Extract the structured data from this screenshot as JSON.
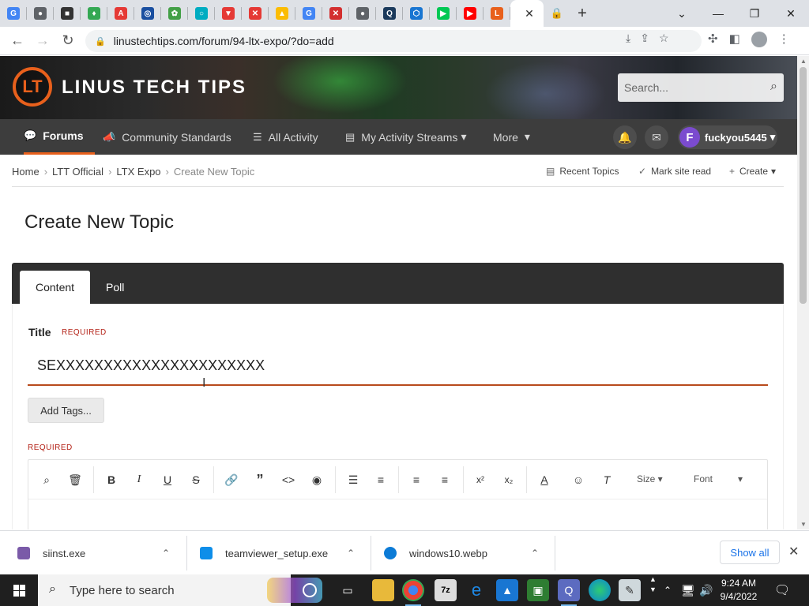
{
  "browser": {
    "tabs": [
      {
        "name": "tab-google",
        "glyph": "G",
        "color": "#4285f4"
      },
      {
        "name": "tab-globe",
        "glyph": "●",
        "color": "#5f6368"
      },
      {
        "name": "tab-dark",
        "glyph": "■",
        "color": "#333333"
      },
      {
        "name": "tab-pin",
        "glyph": "♦",
        "color": "#34a853"
      },
      {
        "name": "tab-adobe",
        "glyph": "A",
        "color": "#e53935"
      },
      {
        "name": "tab-blue-circle",
        "glyph": "◎",
        "color": "#1a4fa0"
      },
      {
        "name": "tab-green",
        "glyph": "✿",
        "color": "#43a047"
      },
      {
        "name": "tab-teal",
        "glyph": "○",
        "color": "#00acc1"
      },
      {
        "name": "tab-shield1",
        "glyph": "▼",
        "color": "#e53935"
      },
      {
        "name": "tab-shield2",
        "glyph": "✕",
        "color": "#e53935"
      },
      {
        "name": "tab-drive",
        "glyph": "▲",
        "color": "#fbbc04"
      },
      {
        "name": "tab-google2",
        "glyph": "G",
        "color": "#4285f4"
      },
      {
        "name": "tab-shield3",
        "glyph": "✕",
        "color": "#d32f2f"
      },
      {
        "name": "tab-globe2",
        "glyph": "●",
        "color": "#5f6368"
      },
      {
        "name": "tab-q",
        "glyph": "Q",
        "color": "#1b3a5c"
      },
      {
        "name": "tab-hex",
        "glyph": "⬡",
        "color": "#1976d2"
      },
      {
        "name": "tab-play",
        "glyph": "▶",
        "color": "#00c853"
      },
      {
        "name": "tab-youtube",
        "glyph": "▶",
        "color": "#ff0000"
      },
      {
        "name": "tab-ltt",
        "glyph": "L",
        "color": "#e8601c"
      }
    ],
    "active_tab_close": "✕",
    "after_tab": {
      "glyph": "🔒",
      "color": "#f5c518"
    },
    "new_tab": "+",
    "url": "linustechtips.com/forum/94-ltx-expo/?do=add"
  },
  "site": {
    "logo_glyph": "LT",
    "logo_text": "LINUS TECH TIPS",
    "search_placeholder": "Search...",
    "nav": [
      {
        "label": "Forums",
        "icon": "💬",
        "active": true
      },
      {
        "label": "Community Standards",
        "icon": "📣"
      },
      {
        "label": "All Activity",
        "icon": "☰"
      },
      {
        "label": "My Activity Streams",
        "icon": "▤",
        "caret": "▾"
      },
      {
        "label": "More",
        "caret": "▾"
      }
    ],
    "user": {
      "initial": "F",
      "name": "fuckyou5445",
      "caret": "▾"
    }
  },
  "breadcrumb": {
    "items": [
      "Home",
      "LTT Official",
      "LTX Expo"
    ],
    "current": "Create New Topic",
    "separator": "›",
    "actions": [
      {
        "label": "Recent Topics",
        "icon": "▤"
      },
      {
        "label": "Mark site read",
        "icon": "✓"
      },
      {
        "label": "Create",
        "icon": "+",
        "caret": "▾"
      }
    ]
  },
  "form": {
    "page_title": "Create New Topic",
    "tabs": [
      "Content",
      "Poll"
    ],
    "title_label": "Title",
    "required": "REQUIRED",
    "title_value": "SEXXXXXXXXXXXXXXXXXXXXXX",
    "add_tags": "Add Tags...",
    "editor_size": "Size",
    "editor_font": "Font"
  },
  "downloads": {
    "items": [
      {
        "name": "siinst.exe",
        "color": "#7a5aa8"
      },
      {
        "name": "teamviewer_setup.exe",
        "color": "#0e8ee9"
      },
      {
        "name": "windows10.webp",
        "color": "#0c7bd6"
      }
    ],
    "show_all": "Show all"
  },
  "taskbar": {
    "search_placeholder": "Type here to search",
    "time": "9:24 AM",
    "date": "9/4/2022"
  }
}
